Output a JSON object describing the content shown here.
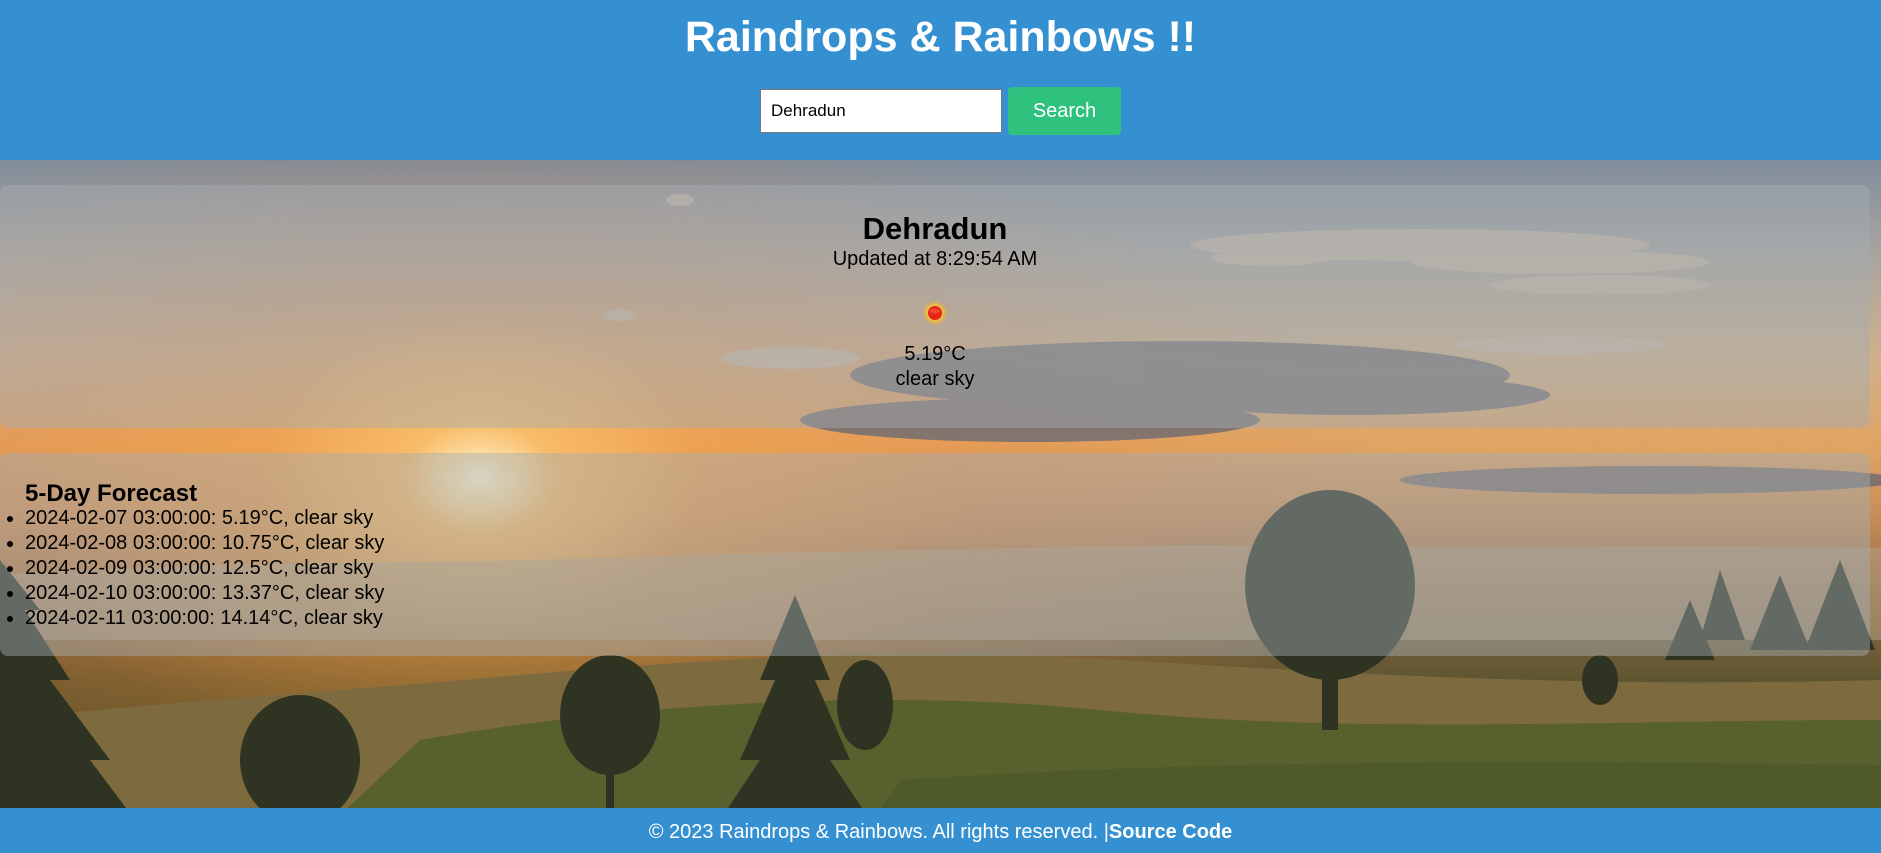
{
  "header": {
    "title": "Raindrops & Rainbows !!",
    "search": {
      "value": "Dehradun",
      "button_label": "Search"
    }
  },
  "current": {
    "city": "Dehradun",
    "updated": "Updated at 8:29:54 AM",
    "icon": "sun-icon",
    "temperature": "5.19°C",
    "description": "clear sky"
  },
  "forecast": {
    "title": "5-Day Forecast",
    "items": [
      "2024-02-07 03:00:00: 5.19°C, clear sky",
      "2024-02-08 03:00:00: 10.75°C, clear sky",
      "2024-02-09 03:00:00: 12.5°C, clear sky",
      "2024-02-10 03:00:00: 13.37°C, clear sky",
      "2024-02-11 03:00:00: 14.14°C, clear sky"
    ]
  },
  "footer": {
    "copyright": "© 2023 Raindrops & Rainbows. All rights reserved. |",
    "link_label": "Source Code"
  },
  "colors": {
    "header_bg": "#3590d2",
    "search_button": "#2ec27e",
    "sun_red": "#e8241a",
    "sun_glow": "#ffc93a"
  }
}
